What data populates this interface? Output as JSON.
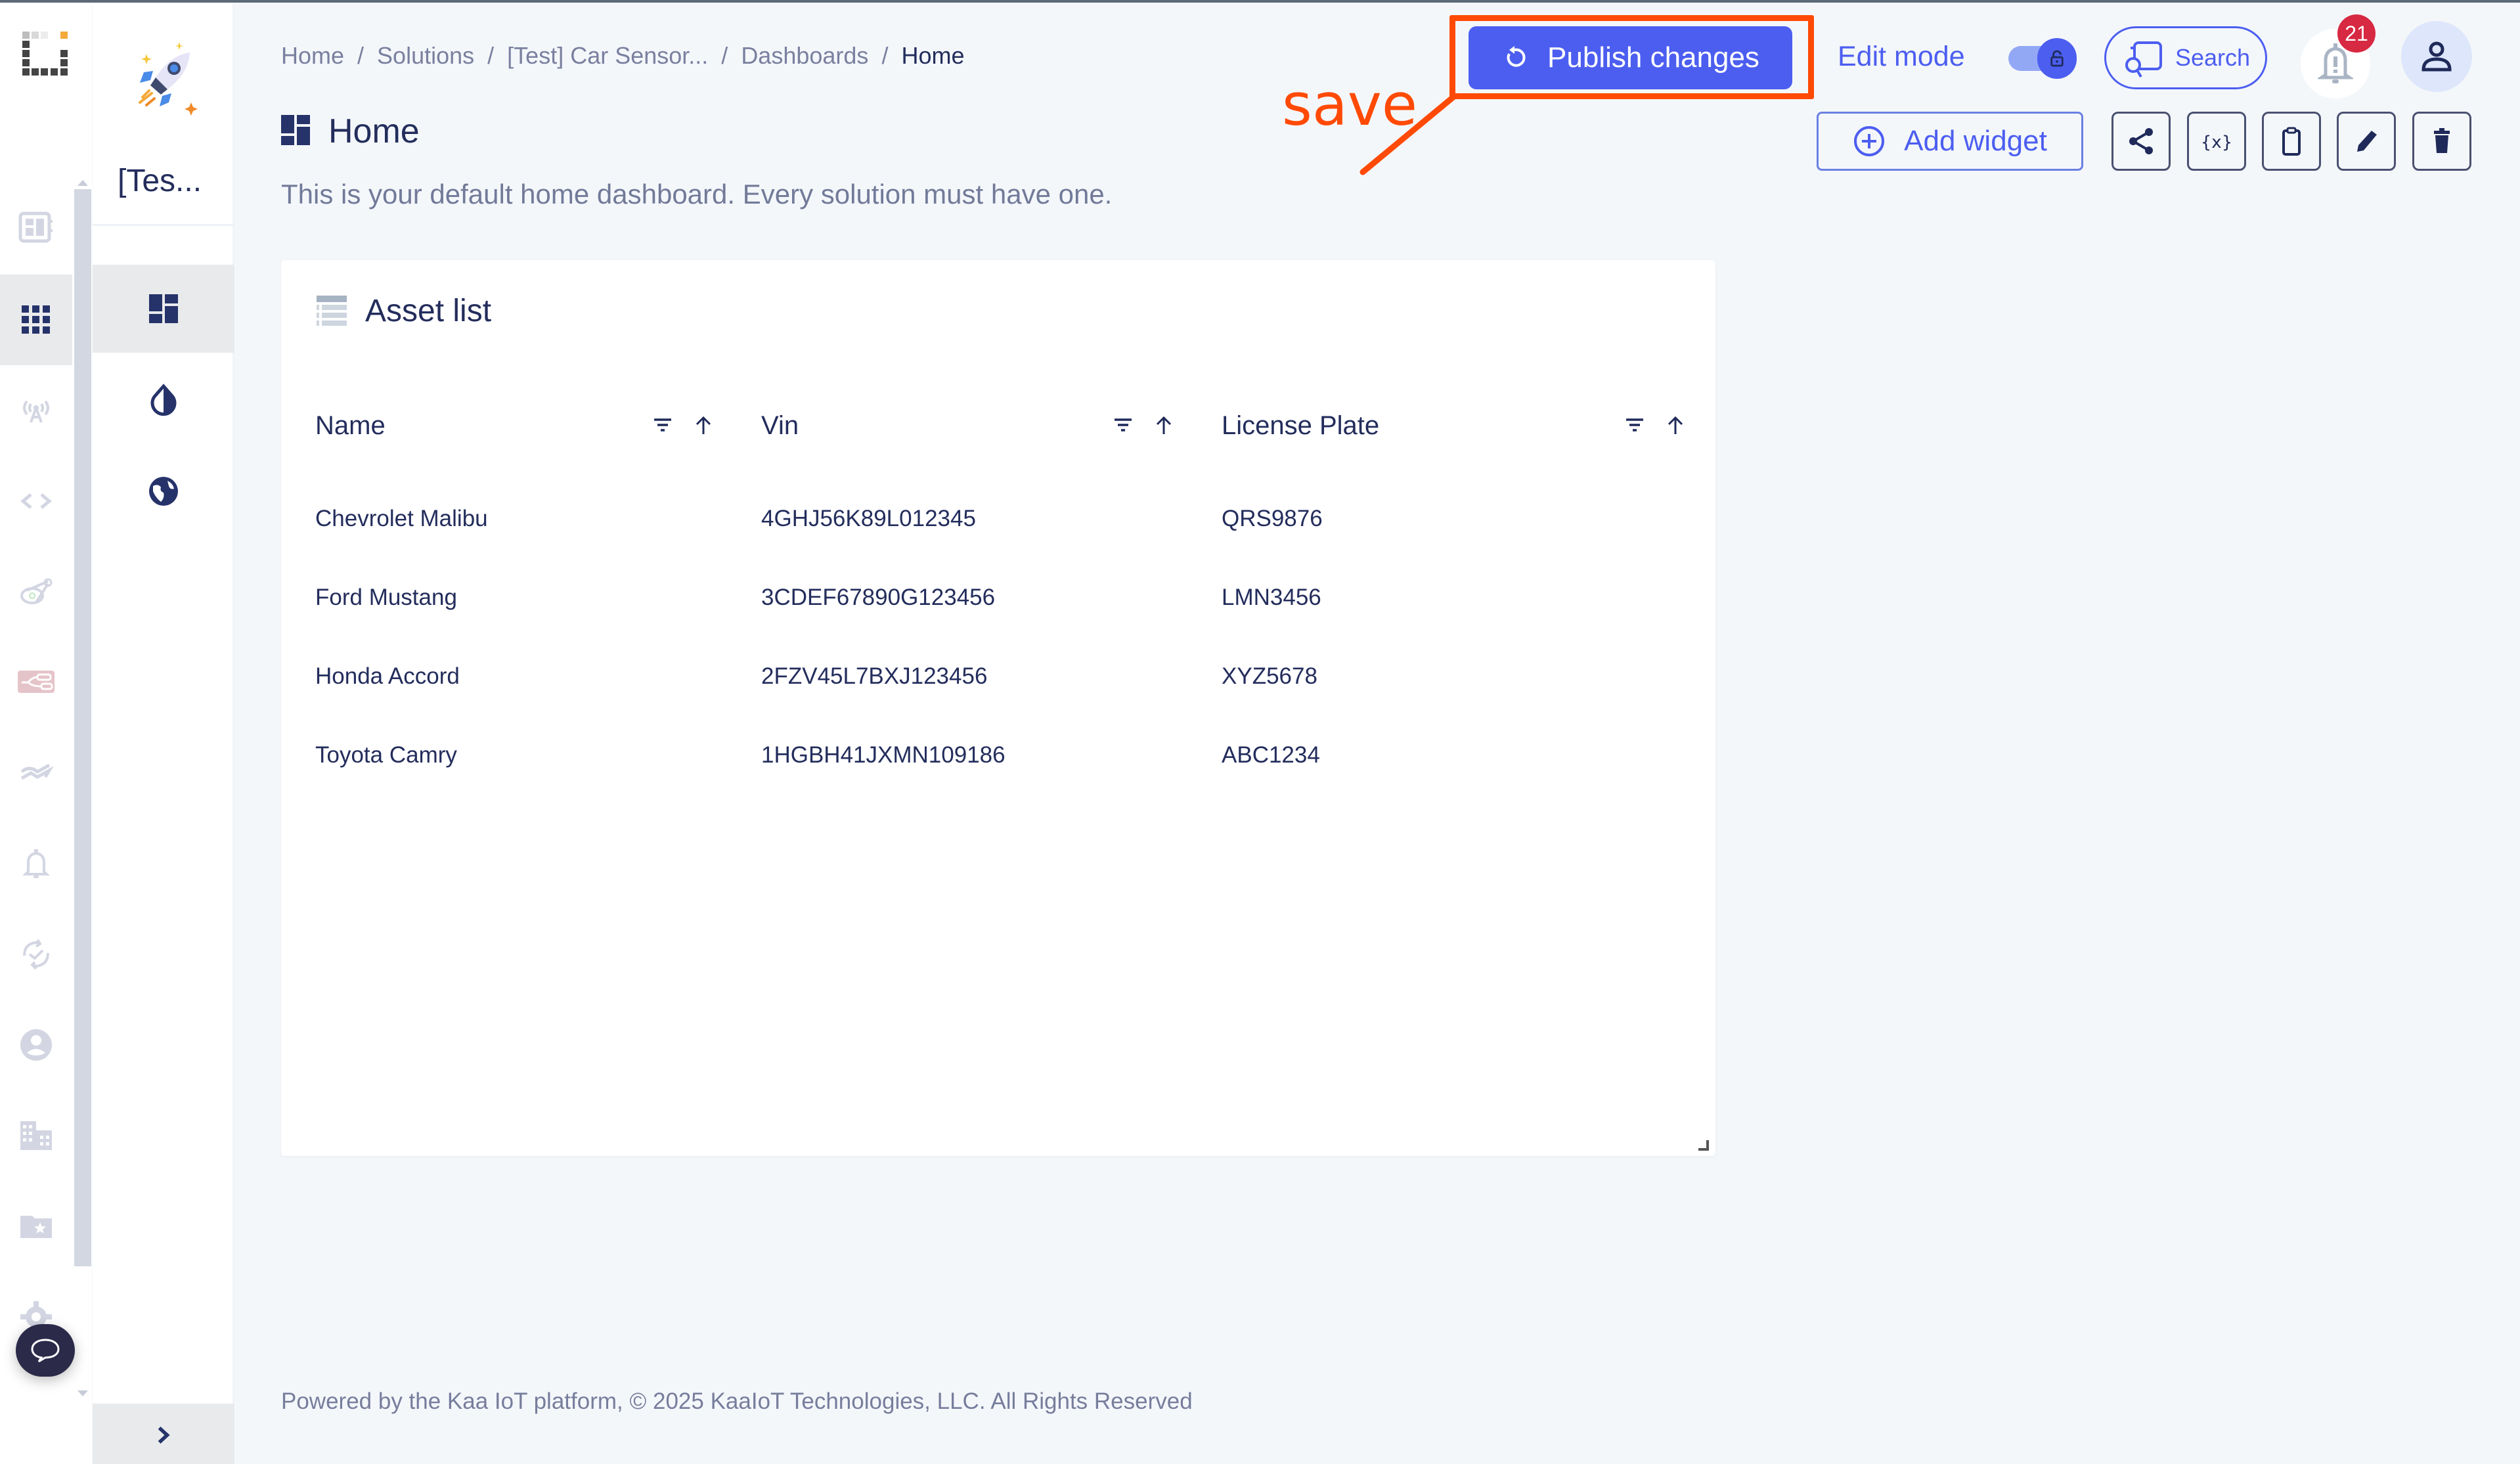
{
  "rail": {
    "logo": "kaa-logo-icon",
    "items": [
      {
        "name": "dashboards",
        "icon": "dashboard-panel-icon",
        "active": false
      },
      {
        "name": "solutions",
        "icon": "apps-grid-icon",
        "active": true
      },
      {
        "name": "devices",
        "icon": "antenna-icon",
        "active": false
      },
      {
        "name": "code",
        "icon": "code-brackets-icon",
        "active": false
      },
      {
        "name": "integrations",
        "icon": "satellite-icon",
        "active": false
      },
      {
        "name": "flows",
        "icon": "node-flow-icon",
        "active": false
      },
      {
        "name": "analytics",
        "icon": "trend-icon",
        "active": false
      },
      {
        "name": "alerts",
        "icon": "bell-icon",
        "active": false
      },
      {
        "name": "sync",
        "icon": "sync-check-icon",
        "active": false
      },
      {
        "name": "users",
        "icon": "account-circle-icon",
        "active": false
      },
      {
        "name": "tenants",
        "icon": "building-icon",
        "active": false
      },
      {
        "name": "favorites",
        "icon": "folder-star-icon",
        "active": false
      },
      {
        "name": "settings",
        "icon": "gear-icon",
        "active": false
      }
    ],
    "chat_icon": "chat-bubble-icon"
  },
  "solution_sidebar": {
    "title": "[Tes...",
    "items": [
      {
        "name": "dashboards",
        "icon": "dashboard-icon",
        "active": true
      },
      {
        "name": "theme",
        "icon": "contrast-drop-icon",
        "active": false
      },
      {
        "name": "public",
        "icon": "globe-icon",
        "active": false
      }
    ],
    "expand_icon": "chevron-right-icon"
  },
  "breadcrumb": [
    {
      "label": "Home",
      "current": false
    },
    {
      "label": "Solutions",
      "current": false
    },
    {
      "label": "[Test] Car Sensor...",
      "current": false
    },
    {
      "label": "Dashboards",
      "current": false
    },
    {
      "label": "Home",
      "current": true
    }
  ],
  "breadcrumb_separator": "/",
  "page": {
    "title": "Home",
    "description": "This is your default home dashboard. Every solution must have one."
  },
  "header": {
    "publish_label": "Publish changes",
    "edit_mode_label": "Edit mode",
    "edit_mode_on": true,
    "search_label": "Search",
    "notification_count": "21",
    "add_widget_label": "Add widget",
    "tools": [
      "share-icon",
      "variables-icon",
      "clipboard-icon",
      "edit-pencil-icon",
      "delete-trash-icon"
    ]
  },
  "annotation": {
    "label": "save",
    "color": "#ff4a06"
  },
  "widget": {
    "title": "Asset list",
    "columns": [
      "Name",
      "Vin",
      "License Plate"
    ],
    "rows": [
      [
        "Chevrolet Malibu",
        "4GHJ56K89L012345",
        "QRS9876"
      ],
      [
        "Ford Mustang",
        "3CDEF67890G123456",
        "LMN3456"
      ],
      [
        "Honda Accord",
        "2FZV45L7BXJ123456",
        "XYZ5678"
      ],
      [
        "Toyota Camry",
        "1HGBH41JXMN109186",
        "ABC1234"
      ]
    ]
  },
  "footer": "Powered by the Kaa IoT platform, © 2025 KaaIoT Technologies, LLC. All Rights Reserved",
  "colors": {
    "primary": "#4c5ef0",
    "navy": "#232d5c",
    "badge": "#d72942",
    "background": "#f4f7fa"
  }
}
